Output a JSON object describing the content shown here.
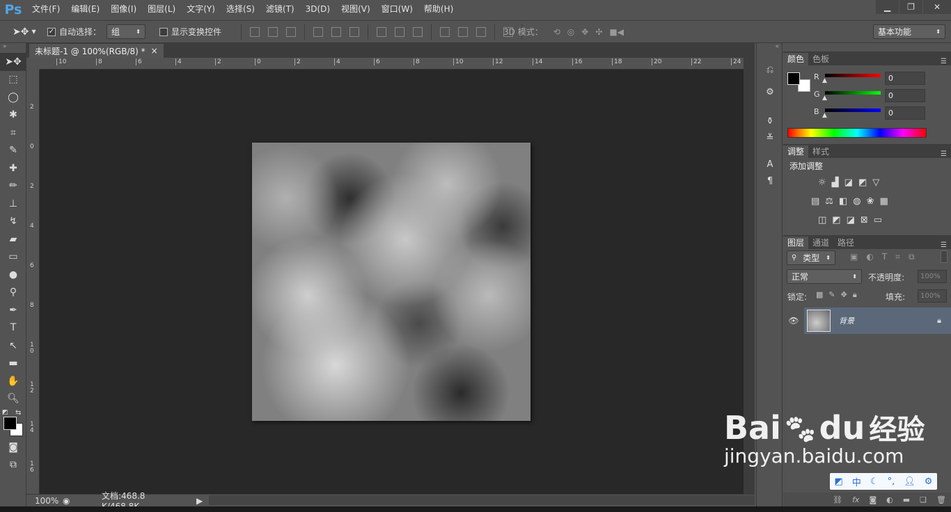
{
  "app": {
    "logo": "Ps"
  },
  "menu": [
    "文件(F)",
    "编辑(E)",
    "图像(I)",
    "图层(L)",
    "文字(Y)",
    "选择(S)",
    "滤镜(T)",
    "3D(D)",
    "视图(V)",
    "窗口(W)",
    "帮助(H)"
  ],
  "window_buttons": {
    "minimize": "▁",
    "restore": "❐",
    "close": "✕"
  },
  "options": {
    "auto_select_label": "自动选择：",
    "auto_select_checked": true,
    "auto_select_value": "组",
    "show_transform_label": "显示变换控件",
    "show_transform_checked": false,
    "mode_3d_label": "3D 模式：",
    "workspace": "基本功能"
  },
  "document": {
    "tab_title": "未标题-1 @ 100%(RGB/8) *",
    "tab_close": "×",
    "zoom": "100%",
    "doc_info": "文档:468.8 K/468.8K"
  },
  "ruler": {
    "h_ticks": [
      "10",
      "8",
      "6",
      "4",
      "2",
      "0",
      "2",
      "4",
      "6",
      "8",
      "10",
      "12",
      "14",
      "16",
      "18",
      "20",
      "22",
      "24"
    ],
    "v_ticks": [
      "2",
      "0",
      "2",
      "4",
      "6",
      "8",
      "1 0",
      "1 2",
      "1 4",
      "1 6"
    ]
  },
  "color_panel": {
    "tabs": [
      "颜色",
      "色板"
    ],
    "r_label": "R",
    "r_value": "0",
    "g_label": "G",
    "g_value": "0",
    "b_label": "B",
    "b_value": "0",
    "foreground": "#000000",
    "background": "#ffffff"
  },
  "adjust_panel": {
    "tabs": [
      "调整",
      "样式"
    ],
    "title": "添加调整"
  },
  "layers_panel": {
    "tabs": [
      "图层",
      "通道",
      "路径"
    ],
    "filter_type": "类型",
    "blend_mode": "正常",
    "opacity_label": "不透明度:",
    "opacity_value": "100%",
    "lock_label": "锁定:",
    "fill_label": "填充:",
    "fill_value": "100%",
    "layer_name": "背景"
  },
  "watermark": {
    "brand_main": "Bai",
    "brand_du": "du",
    "brand_cn": "经验",
    "url": "jingyan.baidu.com"
  },
  "ime": {
    "mode": "中"
  }
}
